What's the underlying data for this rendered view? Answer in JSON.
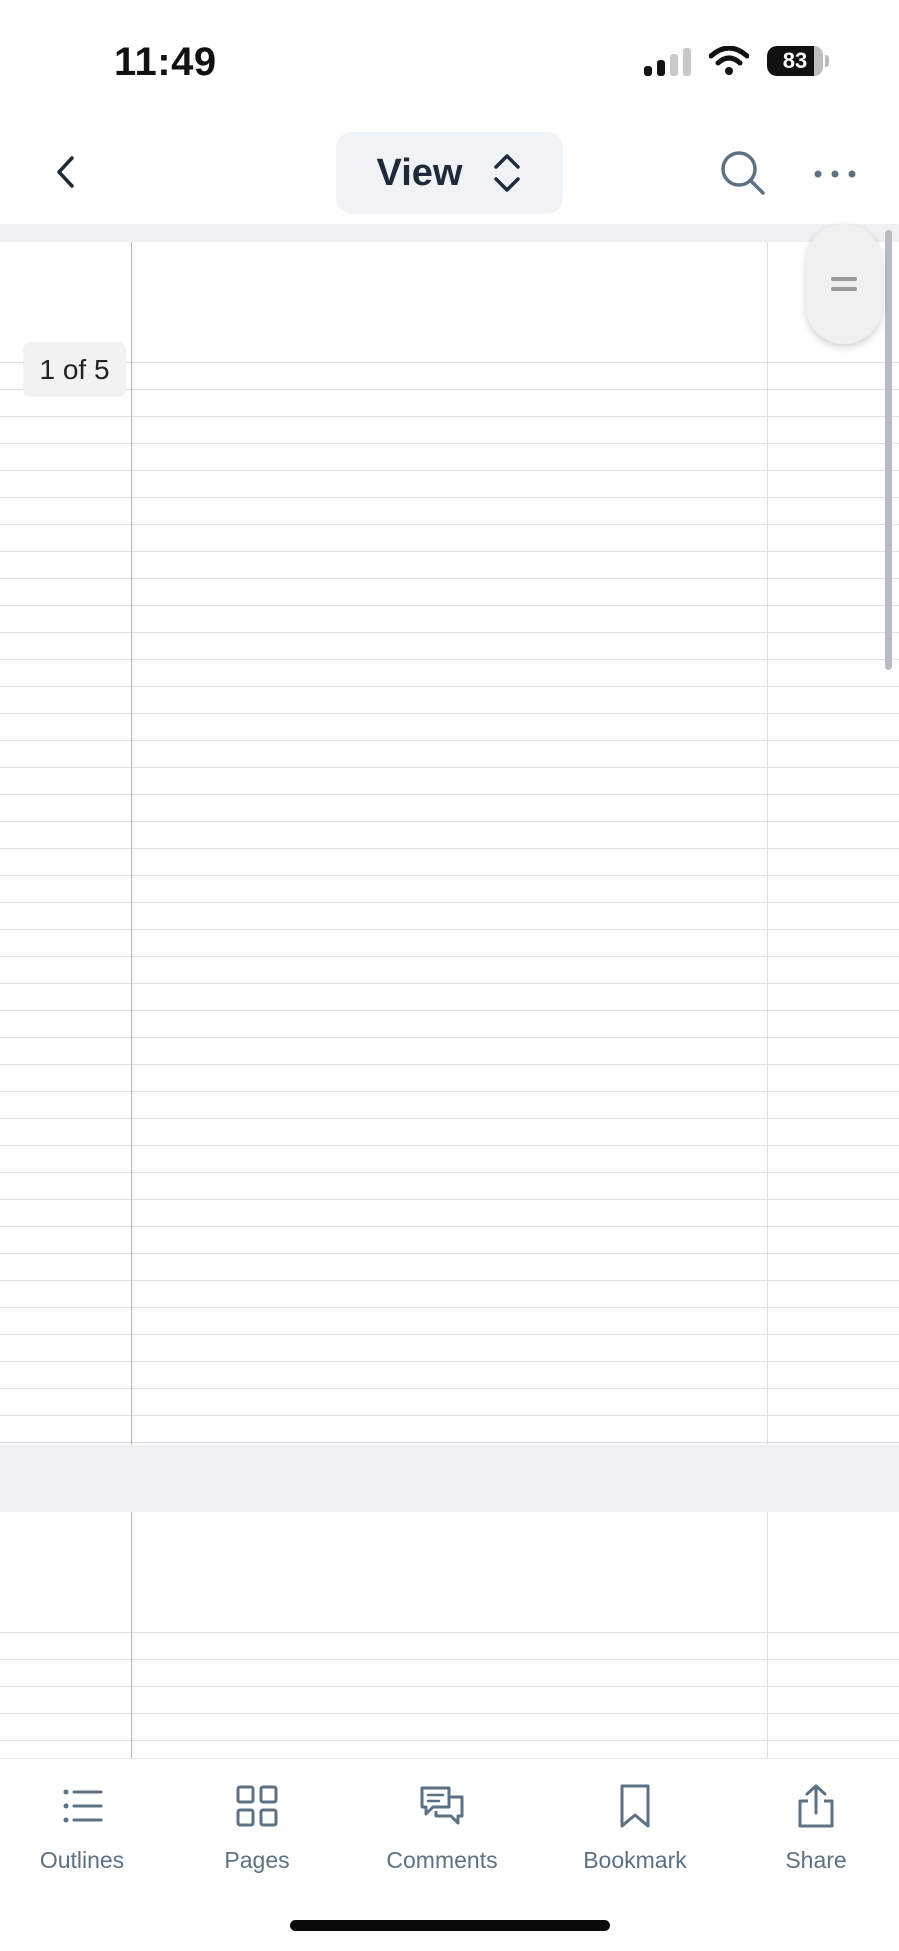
{
  "status_bar": {
    "time": "11:49",
    "battery": "83"
  },
  "nav": {
    "view_label": "View"
  },
  "document": {
    "page_indicator": "1 of 5"
  },
  "tabs": [
    {
      "label": "Outlines",
      "icon": "list-icon"
    },
    {
      "label": "Pages",
      "icon": "grid-icon"
    },
    {
      "label": "Comments",
      "icon": "comments-icon"
    },
    {
      "label": "Bookmark",
      "icon": "bookmark-icon"
    },
    {
      "label": "Share",
      "icon": "share-icon"
    }
  ],
  "colors": {
    "accent": "#5c7183",
    "margin_line": "#e6a3ad",
    "rule_line": "#dcdfe3"
  }
}
